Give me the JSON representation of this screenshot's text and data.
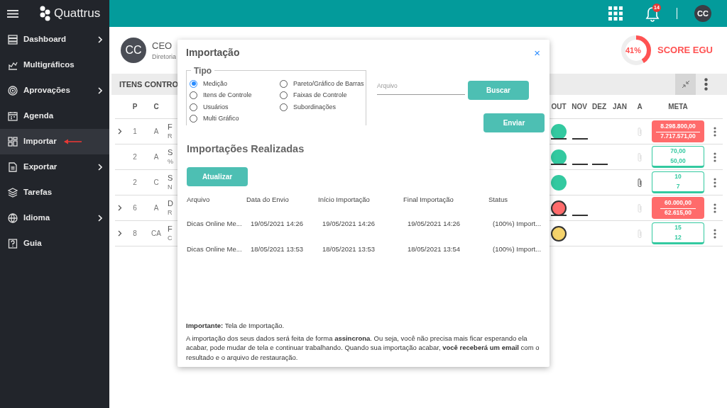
{
  "brand": {
    "name": "Quattrus"
  },
  "topbar": {
    "notifications": "14",
    "user_initials": "CC"
  },
  "sidebar": {
    "items": [
      {
        "label": "Dashboard",
        "has_submenu": true,
        "selected": false
      },
      {
        "label": "Multigráficos",
        "has_submenu": false,
        "selected": false
      },
      {
        "label": "Aprovações",
        "has_submenu": true,
        "selected": false
      },
      {
        "label": "Agenda",
        "has_submenu": false,
        "selected": false
      },
      {
        "label": "Importar",
        "has_submenu": false,
        "selected": true,
        "pointer": true
      },
      {
        "label": "Exportar",
        "has_submenu": true,
        "selected": false
      },
      {
        "label": "Tarefas",
        "has_submenu": false,
        "selected": false
      },
      {
        "label": "Idioma",
        "has_submenu": true,
        "selected": false
      },
      {
        "label": "Guia",
        "has_submenu": false,
        "selected": false
      }
    ]
  },
  "profile": {
    "initials": "CC",
    "role": "CEO",
    "department": "Diretoria"
  },
  "score": {
    "value": "41%",
    "label": "SCORE EGU",
    "level": 0.41
  },
  "section": {
    "title": "ITENS CONTRO"
  },
  "table": {
    "columns": [
      "P",
      "C",
      "OUT",
      "NOV",
      "DEZ",
      "JAN",
      "A",
      "META"
    ],
    "rows": [
      {
        "expandable": true,
        "p": "1",
        "c": "A",
        "name": "F",
        "detail": "R",
        "status": {
          "color": "#33c9a0",
          "outlined": false
        },
        "dashes": [
          true,
          true,
          false
        ],
        "attachment": false,
        "meta": {
          "color": "#ff6b6b",
          "filled": true,
          "target": "8.298.800,00",
          "actual": "7.717.571,00"
        }
      },
      {
        "expandable": false,
        "p": "2",
        "c": "A",
        "name": "S",
        "detail": "%",
        "status": {
          "color": "#33c9a0",
          "outlined": false
        },
        "dashes": [
          true,
          true,
          true
        ],
        "attachment": false,
        "meta": {
          "color": "#33c9a0",
          "filled": false,
          "target": "70,00",
          "actual": "50,00"
        }
      },
      {
        "expandable": false,
        "p": "2",
        "c": "C",
        "name": "S",
        "detail": "N",
        "status": {
          "color": "#33c9a0",
          "outlined": false
        },
        "dashes": [
          false,
          false,
          false
        ],
        "attachment": true,
        "meta": {
          "color": "#33c9a0",
          "filled": false,
          "target": "10",
          "actual": "7"
        }
      },
      {
        "expandable": true,
        "p": "6",
        "c": "A",
        "name": "D",
        "detail": "R",
        "status": {
          "color": "#ff6b6b",
          "outlined": true
        },
        "dashes": [
          true,
          true,
          false
        ],
        "attachment": false,
        "meta": {
          "color": "#ff6b6b",
          "filled": true,
          "target": "60.000,00",
          "actual": "62.615,00"
        }
      },
      {
        "expandable": true,
        "p": "8",
        "c": "CA",
        "name": "F",
        "detail": "C",
        "status": {
          "color": "#f5d36b",
          "outlined": true
        },
        "dashes": [
          false,
          false,
          false
        ],
        "attachment": false,
        "meta": {
          "color": "#33c9a0",
          "filled": false,
          "target": "15",
          "actual": "12"
        }
      }
    ]
  },
  "modal": {
    "title": "Importação",
    "close": "×",
    "type_group": {
      "legend": "Tipo",
      "options": [
        {
          "label": "Medição",
          "selected": true
        },
        {
          "label": "Itens de Controle",
          "selected": false
        },
        {
          "label": "Usuários",
          "selected": false
        },
        {
          "label": "Multi Gráfico",
          "selected": false
        },
        {
          "label": "Pareto/Gráfico de Barras",
          "selected": false
        },
        {
          "label": "Faixas de Controle",
          "selected": false
        },
        {
          "label": "Subordinações",
          "selected": false
        }
      ]
    },
    "file_field": {
      "label": "Arquivo"
    },
    "buttons": {
      "browse": "Buscar",
      "send": "Enviar",
      "refresh": "Atualizar"
    },
    "history_title": "Importações Realizadas",
    "history": {
      "columns": [
        "Arquivo",
        "Data do Envio",
        "Início Importação",
        "Final Importação",
        "Status"
      ],
      "rows": [
        [
          "Dicas Online Me...",
          "19/05/2021 14:26",
          "19/05/2021 14:26",
          "19/05/2021 14:26",
          "(100%) Import..."
        ],
        [
          "Dicas Online Me...",
          "18/05/2021 13:53",
          "18/05/2021 13:53",
          "18/05/2021 13:54",
          "(100%) Import..."
        ]
      ]
    },
    "note_title": "**Importante:** Tela de Importação.",
    "note": "A importação dos seus dados será feita de forma **assincrona**. Ou seja, você não precisa mais ficar esperando ela acabar, pode mudar de tela e continuar trabalhando. Quando sua importação acabar, **você receberá um email** com o resultado e o arquivo de restauração."
  }
}
